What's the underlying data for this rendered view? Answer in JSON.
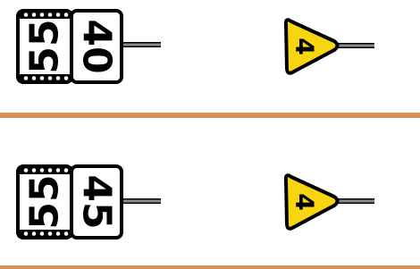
{
  "colors": {
    "background": "#ffffff",
    "divider": "#d4935c",
    "triangle_fill": "#f7d60f",
    "stroke": "#000000",
    "pole": "#8a8a8a",
    "board_fill": "#ffffff"
  },
  "rows": [
    {
      "board_left": "55",
      "board_right": "40",
      "triangle_value": "4"
    },
    {
      "board_left": "55",
      "board_right": "45",
      "triangle_value": "4"
    }
  ]
}
